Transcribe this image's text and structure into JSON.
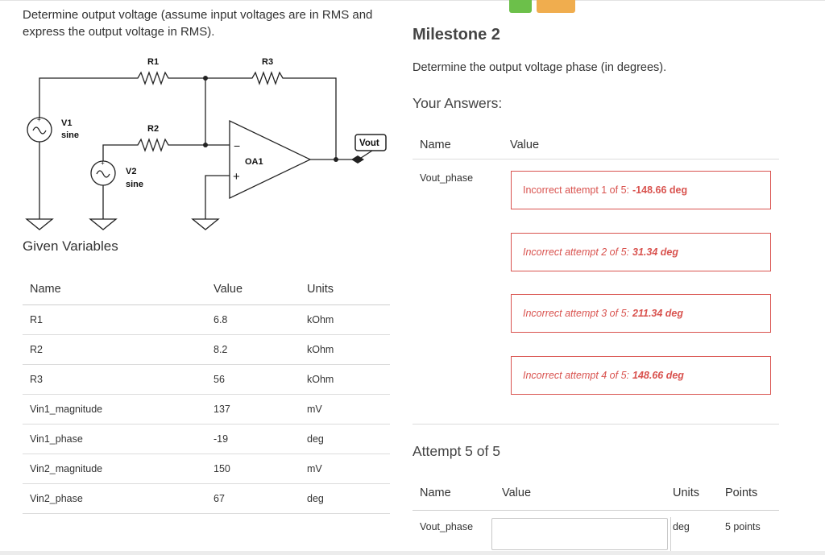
{
  "question": {
    "text": "Determine output voltage (assume input voltages are in RMS and express the output voltage in RMS)."
  },
  "circuit": {
    "labels": {
      "r1": "R1",
      "r2": "R2",
      "r3": "R3",
      "v1": "V1",
      "v1_type": "sine",
      "v2": "V2",
      "v2_type": "sine",
      "opamp": "OA1",
      "vout": "Vout",
      "minus": "−",
      "plus": "+"
    }
  },
  "given": {
    "title": "Given Variables",
    "headers": {
      "name": "Name",
      "value": "Value",
      "units": "Units"
    },
    "rows": [
      {
        "name": "R1",
        "value": "6.8",
        "units": "kOhm"
      },
      {
        "name": "R2",
        "value": "8.2",
        "units": "kOhm"
      },
      {
        "name": "R3",
        "value": "56",
        "units": "kOhm"
      },
      {
        "name": "Vin1_magnitude",
        "value": "137",
        "units": "mV"
      },
      {
        "name": "Vin1_phase",
        "value": "-19",
        "units": "deg"
      },
      {
        "name": "Vin2_magnitude",
        "value": "150",
        "units": "mV"
      },
      {
        "name": "Vin2_phase",
        "value": "67",
        "units": "deg"
      }
    ]
  },
  "milestone": {
    "title": "Milestone 2",
    "prompt": "Determine the output voltage phase (in degrees).",
    "your_answers": "Your Answers:",
    "headers": {
      "name": "Name",
      "value": "Value"
    },
    "variable": "Vout_phase",
    "attempts": [
      {
        "label": "Incorrect attempt 1 of 5:",
        "value": "-148.66 deg"
      },
      {
        "label": "Incorrect attempt 2 of 5:",
        "value": "31.34 deg"
      },
      {
        "label": "Incorrect attempt 3 of 5:",
        "value": "211.34 deg"
      },
      {
        "label": "Incorrect attempt 4 of 5:",
        "value": "148.66 deg"
      }
    ],
    "error_color": "#d9534f"
  },
  "attempt_form": {
    "title": "Attempt 5 of 5",
    "headers": {
      "name": "Name",
      "value": "Value",
      "units": "Units",
      "points": "Points"
    },
    "variable": "Vout_phase",
    "input_value": "",
    "units": "deg",
    "points": "5 points"
  }
}
